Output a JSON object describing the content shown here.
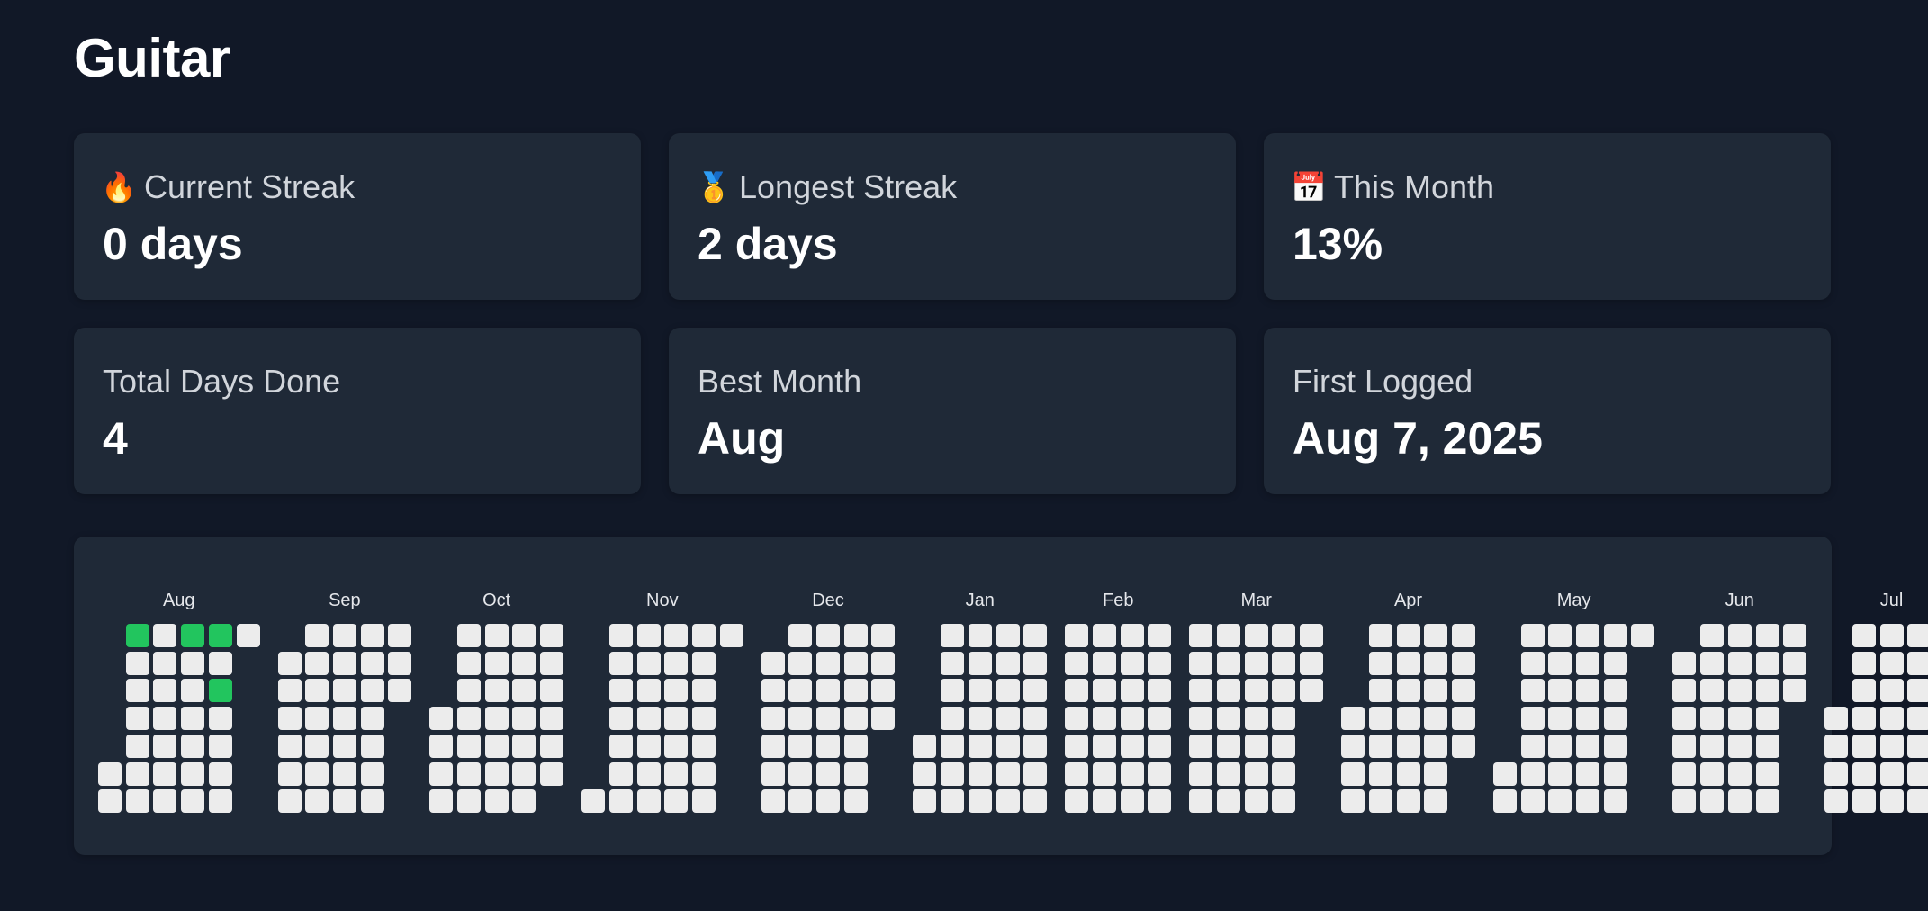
{
  "title": "Guitar",
  "stats": [
    {
      "icon": "🔥",
      "icon_name": "fire-icon",
      "label": "Current Streak",
      "value": "0 days"
    },
    {
      "icon": "🥇",
      "icon_name": "medal-icon",
      "label": "Longest Streak",
      "value": "2 days"
    },
    {
      "icon": "📅",
      "icon_name": "calendar-icon",
      "label": "This Month",
      "value": "13%"
    },
    {
      "icon": "",
      "icon_name": "",
      "label": "Total Days Done",
      "value": "4"
    },
    {
      "icon": "",
      "icon_name": "",
      "label": "Best Month",
      "value": "Aug"
    },
    {
      "icon": "",
      "icon_name": "",
      "label": "First Logged",
      "value": "Aug 7, 2025"
    }
  ],
  "calendar": {
    "months": [
      {
        "label": "Aug",
        "year": 2025,
        "month": 8
      },
      {
        "label": "Sep",
        "year": 2025,
        "month": 9
      },
      {
        "label": "Oct",
        "year": 2025,
        "month": 10
      },
      {
        "label": "Nov",
        "year": 2025,
        "month": 11
      },
      {
        "label": "Dec",
        "year": 2025,
        "month": 12
      },
      {
        "label": "Jan",
        "year": 2026,
        "month": 1
      },
      {
        "label": "Feb",
        "year": 2026,
        "month": 2
      },
      {
        "label": "Mar",
        "year": 2026,
        "month": 3
      },
      {
        "label": "Apr",
        "year": 2026,
        "month": 4
      },
      {
        "label": "May",
        "year": 2026,
        "month": 5
      },
      {
        "label": "Jun",
        "year": 2026,
        "month": 6
      },
      {
        "label": "Jul",
        "year": 2026,
        "month": 7
      }
    ],
    "done_dates": [
      "2025-08-03",
      "2025-08-17",
      "2025-08-24",
      "2025-08-26"
    ],
    "colors": {
      "empty": "#ececec",
      "done": "#22c55e"
    }
  }
}
